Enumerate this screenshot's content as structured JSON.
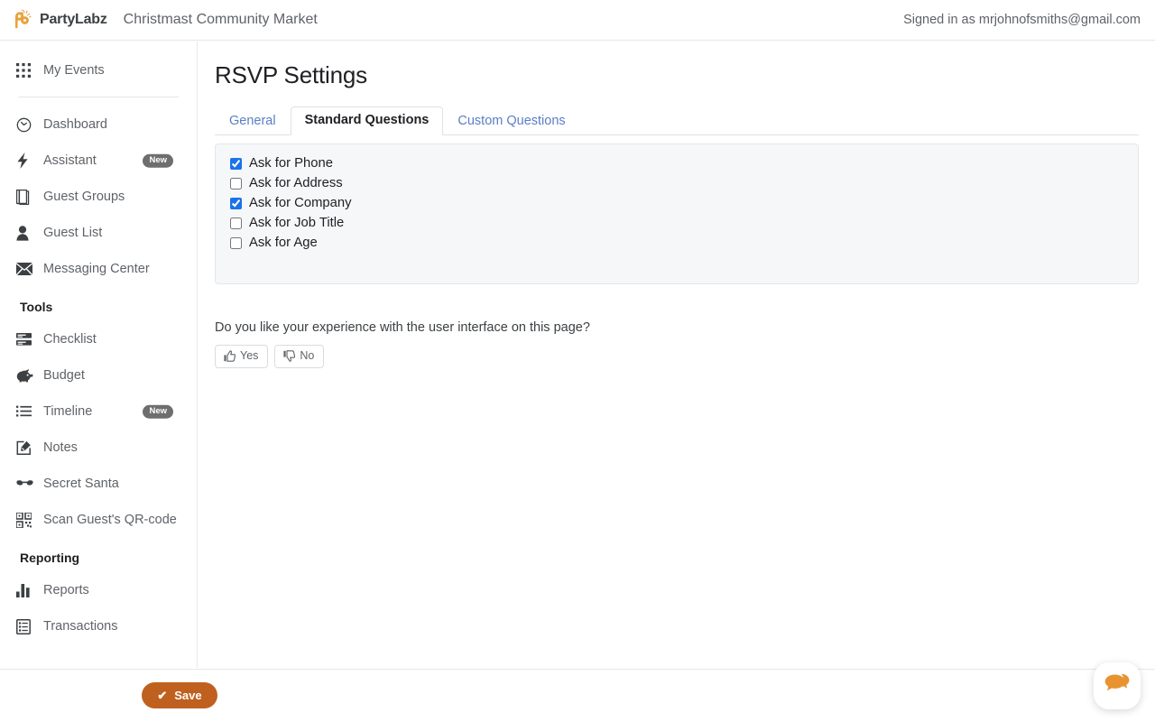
{
  "topbar": {
    "brand_name": "PartyLabz",
    "event_title": "Christmast Community Market",
    "signed_in": "Signed in as mrjohnofsmiths@gmail.com"
  },
  "sidebar": {
    "top_items": [
      {
        "label": "My Events",
        "icon": "grid-icon",
        "badge": ""
      }
    ],
    "main_items": [
      {
        "label": "Dashboard",
        "icon": "clock-icon",
        "badge": ""
      },
      {
        "label": "Assistant",
        "icon": "bolt-icon",
        "badge": "New"
      },
      {
        "label": "Guest Groups",
        "icon": "book-icon",
        "badge": ""
      },
      {
        "label": "Guest List",
        "icon": "person-icon",
        "badge": ""
      },
      {
        "label": "Messaging Center",
        "icon": "envelope-icon",
        "badge": ""
      }
    ],
    "tools_heading": "Tools",
    "tools_items": [
      {
        "label": "Checklist",
        "icon": "checklist-icon",
        "badge": ""
      },
      {
        "label": "Budget",
        "icon": "piggy-bank-icon",
        "badge": ""
      },
      {
        "label": "Timeline",
        "icon": "list-icon",
        "badge": "New"
      },
      {
        "label": "Notes",
        "icon": "edit-note-icon",
        "badge": ""
      },
      {
        "label": "Secret Santa",
        "icon": "glasses-icon",
        "badge": ""
      },
      {
        "label": "Scan Guest's QR-code",
        "icon": "qr-code-icon",
        "badge": ""
      }
    ],
    "reporting_heading": "Reporting",
    "reporting_items": [
      {
        "label": "Reports",
        "icon": "bar-chart-icon",
        "badge": ""
      },
      {
        "label": "Transactions",
        "icon": "receipt-icon",
        "badge": ""
      }
    ]
  },
  "main": {
    "page_title": "RSVP Settings",
    "tabs": [
      {
        "label": "General",
        "active": false
      },
      {
        "label": "Standard Questions",
        "active": true
      },
      {
        "label": "Custom Questions",
        "active": false
      }
    ],
    "standard_questions": [
      {
        "label": "Ask for Phone",
        "checked": true
      },
      {
        "label": "Ask for Address",
        "checked": false
      },
      {
        "label": "Ask for Company",
        "checked": true
      },
      {
        "label": "Ask for Job Title",
        "checked": false
      },
      {
        "label": "Ask for Age",
        "checked": false
      }
    ],
    "feedback": {
      "question": "Do you like your experience with the user interface on this page?",
      "yes_label": "Yes",
      "no_label": "No"
    }
  },
  "bottombar": {
    "save_label": "Save",
    "save_check_glyph": "✔"
  },
  "chat": {
    "icon": "chat-bubbles-icon"
  },
  "colors": {
    "brand_orange": "#e8a33d",
    "save_button": "#c0601f",
    "tab_link": "#5b7ec4",
    "panel_bg": "#f6f7f9",
    "checkbox_accent": "#1a73e8",
    "badge_gray": "#6e6e6e"
  }
}
